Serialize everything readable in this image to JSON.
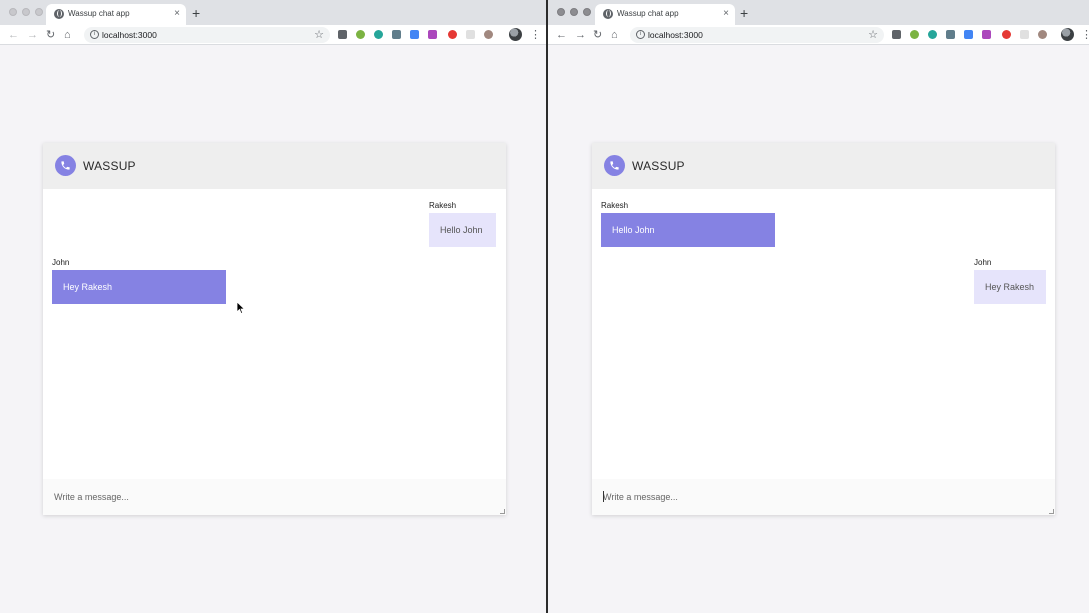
{
  "browser": {
    "tab_title": "Wassup chat app",
    "tab_close": "×",
    "new_tab": "+",
    "url": "localhost:3000",
    "back": "←",
    "forward": "→",
    "reload": "↻",
    "home": "⌂",
    "star": "☆",
    "info": "i",
    "menu": "⋮"
  },
  "app": {
    "brand": "WASSUP",
    "icon": "phone-icon",
    "accent": "#8582e3",
    "mine_bubble_color": "#e6e4fb",
    "composer_placeholder": "Write a message..."
  },
  "windows": [
    {
      "user": "John",
      "messages": [
        {
          "author": "Rakesh",
          "text": "Hello John",
          "side": "right"
        },
        {
          "author": "John",
          "text": "Hey Rakesh",
          "side": "left"
        }
      ]
    },
    {
      "user": "Rakesh",
      "messages": [
        {
          "author": "Rakesh",
          "text": "Hello John",
          "side": "left"
        },
        {
          "author": "John",
          "text": "Hey Rakesh",
          "side": "right"
        }
      ]
    }
  ]
}
